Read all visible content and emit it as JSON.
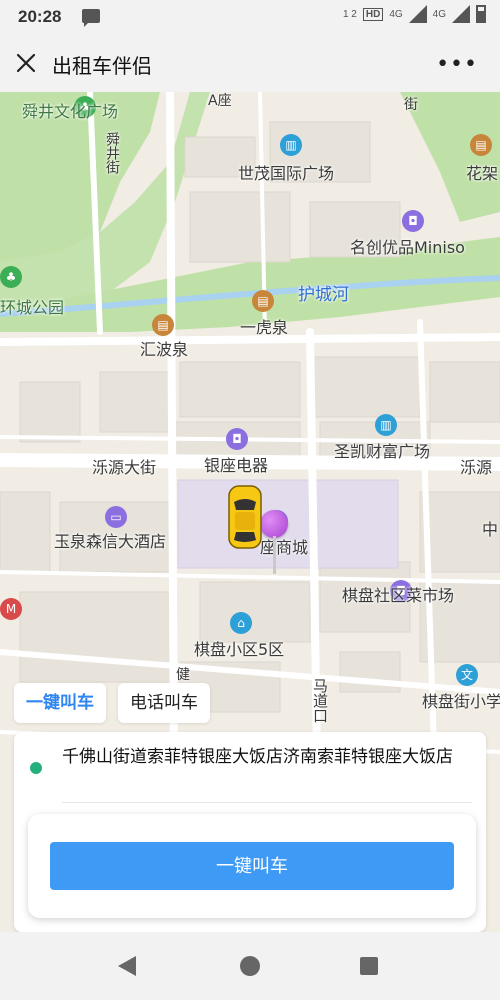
{
  "status_bar": {
    "time": "20:28",
    "network": "4G",
    "network2": "4G",
    "hd_label": "HD",
    "sim": "1 2"
  },
  "header": {
    "title": "出租车伴侣"
  },
  "map": {
    "labels": {
      "shunjing": "舜井文化广场",
      "a_zuo": "A座",
      "shunjing_street": "舜井街",
      "jie": "街",
      "huajia": "花架",
      "shimao": "世茂国际广场",
      "miniso": "名创优品Miniso",
      "huchenghe": "护城河",
      "huancheng": "环城公园",
      "yihuquan": "一虎泉",
      "huibo": "汇波泉",
      "luoyuan1": "泺源大街",
      "luoyuan2": "泺源",
      "yinzuo_dianqi": "银座电器",
      "shengkai": "圣凯财富广场",
      "yuquan": "玉泉森信大酒店",
      "shangcheng": "座商城",
      "zhong": "中",
      "qipan_market": "棋盘社区菜市场",
      "qipan_5": "棋盘小区5区",
      "madao": "马道口",
      "qipan_school": "棋盘街小学",
      "jian": "健"
    }
  },
  "panel": {
    "tabs": [
      {
        "label": "一键叫车",
        "active": true
      },
      {
        "label": "电话叫车",
        "active": false
      }
    ],
    "address": "千佛山街道索菲特银座大饭店济南索菲特银座大饭店",
    "call_button": "一键叫车"
  },
  "colors": {
    "accent": "#3e9af5",
    "tab_active": "#2f86f0",
    "origin_dot": "#22b07d",
    "river": "#a9d1f0",
    "park": "#bfe0a6"
  }
}
